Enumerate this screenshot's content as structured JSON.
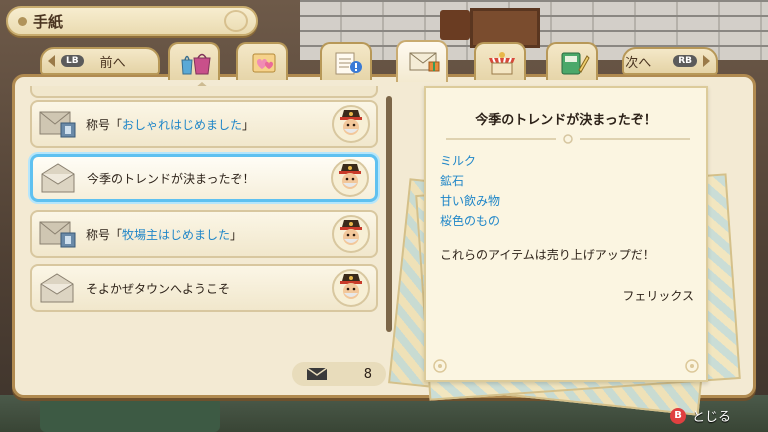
{
  "window": {
    "title": "手紙"
  },
  "nav": {
    "prev": {
      "button": "LB",
      "label": "前へ"
    },
    "next": {
      "label": "次へ",
      "button": "RB"
    }
  },
  "tabs": [
    {
      "icon": "bags-icon",
      "active": false
    },
    {
      "icon": "hearts-icon",
      "active": false
    },
    {
      "icon": "notice-icon",
      "active": false
    },
    {
      "icon": "letter-icon",
      "active": true
    },
    {
      "icon": "shop-icon",
      "active": false
    },
    {
      "icon": "notebook-icon",
      "active": false
    }
  ],
  "letters": [
    {
      "prefix": "称号「",
      "highlight": "おしゃれはじめました",
      "suffix": "」",
      "sender_icon": "felix-avatar-icon",
      "attachment": true,
      "selected": false
    },
    {
      "prefix": "今季のトレンドが決まったぞ！",
      "highlight": "",
      "suffix": "",
      "sender_icon": "felix-avatar-icon",
      "attachment": false,
      "selected": true
    },
    {
      "prefix": "称号「",
      "highlight": "牧場主はじめました",
      "suffix": "」",
      "sender_icon": "felix-avatar-icon",
      "attachment": true,
      "selected": false
    },
    {
      "prefix": "そよかぜタウンへようこそ",
      "highlight": "",
      "suffix": "",
      "sender_icon": "felix-avatar-icon",
      "attachment": false,
      "selected": false
    }
  ],
  "mail_count": {
    "value": "8"
  },
  "preview": {
    "title": "今季のトレンドが決まったぞ！",
    "items": [
      "ミルク",
      "鉱石",
      "甘い飲み物",
      "桜色のもの"
    ],
    "body": "これらのアイテムは売り上げアップだ！",
    "signature": "フェリックス"
  },
  "close_hint": {
    "button": "B",
    "label": "とじる"
  },
  "colors": {
    "accent_blue": "#1f86c8",
    "selection": "#5fc1f0",
    "panel": "#f3ead3"
  }
}
